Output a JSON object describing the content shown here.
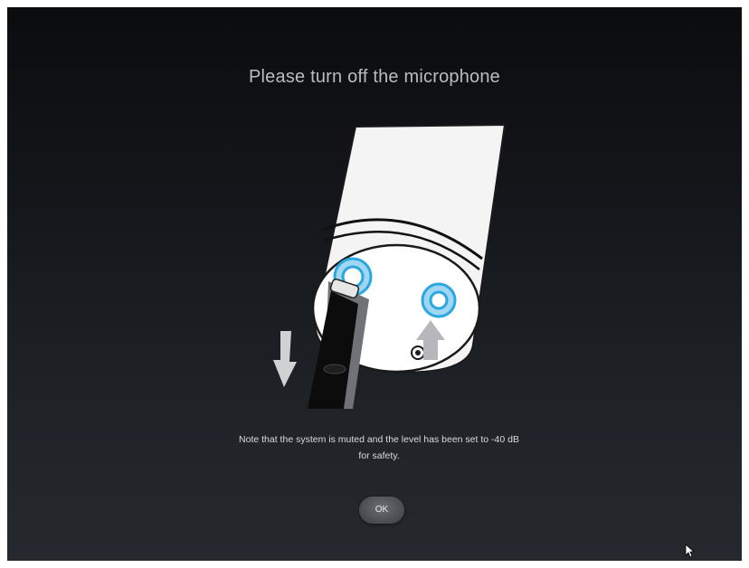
{
  "dialog": {
    "title": "Please turn off the microphone",
    "note_line1": "Note that the system is muted and the level has been set to -40 dB",
    "note_line2": "for safety.",
    "ok_label": "OK"
  },
  "illustration": {
    "icon": "microphone-xlr-unplug-icon",
    "accent_color": "#2aa6e0"
  },
  "colors": {
    "background_top": "#0b0c0e",
    "background_bottom": "#25292e",
    "title_text": "#b9bcc0",
    "button": "#4d5156"
  }
}
